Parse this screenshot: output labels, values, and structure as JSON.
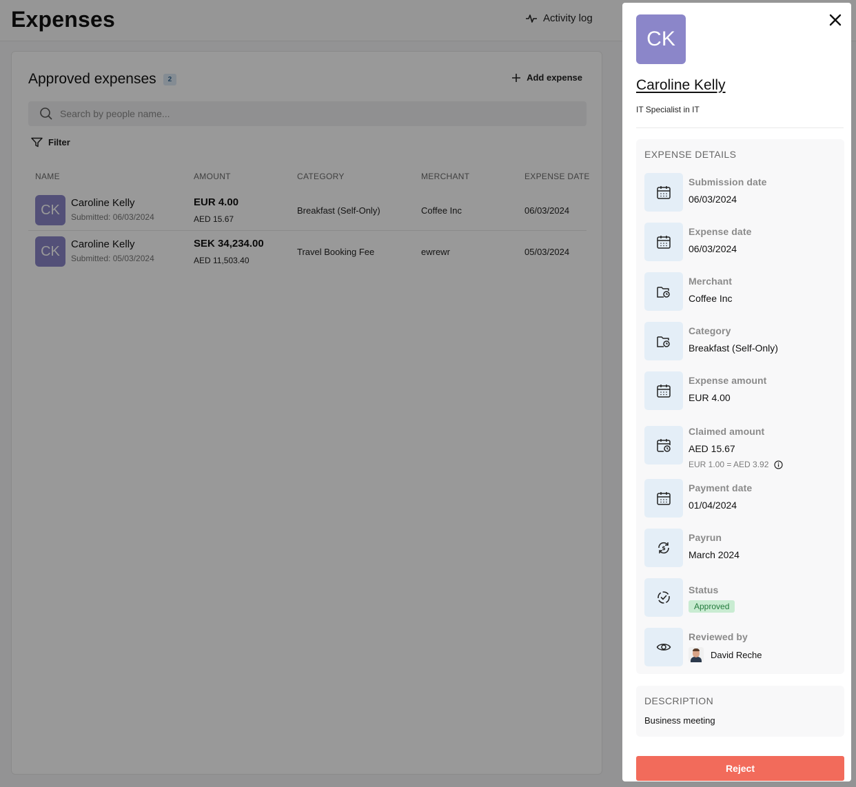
{
  "page": {
    "title": "Expenses",
    "activity_log": "Activity log"
  },
  "list": {
    "title": "Approved expenses",
    "count": "2",
    "add_expense": "Add expense",
    "search_placeholder": "Search by people name...",
    "filter": "Filter",
    "columns": [
      "NAME",
      "AMOUNT",
      "CATEGORY",
      "MERCHANT",
      "EXPENSE DATE"
    ],
    "rows": [
      {
        "initials": "CK",
        "name": "Caroline Kelly",
        "submitted": "Submitted: 06/03/2024",
        "amount": "EUR 4.00",
        "amount_converted": "AED 15.67",
        "category": "Breakfast (Self-Only)",
        "merchant": "Coffee Inc",
        "date": "06/03/2024"
      },
      {
        "initials": "CK",
        "name": "Caroline Kelly",
        "submitted": "Submitted: 05/03/2024",
        "amount": "SEK 34,234.00",
        "amount_converted": "AED 11,503.40",
        "category": "Travel Booking Fee",
        "merchant": "ewrewr",
        "date": "05/03/2024"
      }
    ]
  },
  "drawer": {
    "initials": "CK",
    "name": "Caroline Kelly",
    "role": "IT Specialist in IT",
    "details_title": "EXPENSE DETAILS",
    "submission_date": {
      "label": "Submission date",
      "value": "06/03/2024"
    },
    "expense_date": {
      "label": "Expense date",
      "value": "06/03/2024"
    },
    "merchant": {
      "label": "Merchant",
      "value": "Coffee Inc"
    },
    "category": {
      "label": "Category",
      "value": "Breakfast (Self-Only)"
    },
    "expense_amount": {
      "label": "Expense amount",
      "value": "EUR 4.00"
    },
    "claimed_amount": {
      "label": "Claimed amount",
      "value": "AED 15.67",
      "rate": "EUR 1.00 = AED 3.92"
    },
    "payment_date": {
      "label": "Payment date",
      "value": "01/04/2024"
    },
    "payrun": {
      "label": "Payrun",
      "value": "March 2024"
    },
    "status": {
      "label": "Status",
      "value": "Approved"
    },
    "reviewed_by": {
      "label": "Reviewed by",
      "value": "David Reche"
    },
    "description_title": "DESCRIPTION",
    "description": "Business meeting",
    "reject_label": "Reject"
  },
  "colors": {
    "accent_avatar": "#8b86c9",
    "reject": "#f26b5b",
    "approved_bg": "#c9ecd2",
    "approved_text": "#237a3c",
    "icon_tile": "#e4eef7"
  }
}
